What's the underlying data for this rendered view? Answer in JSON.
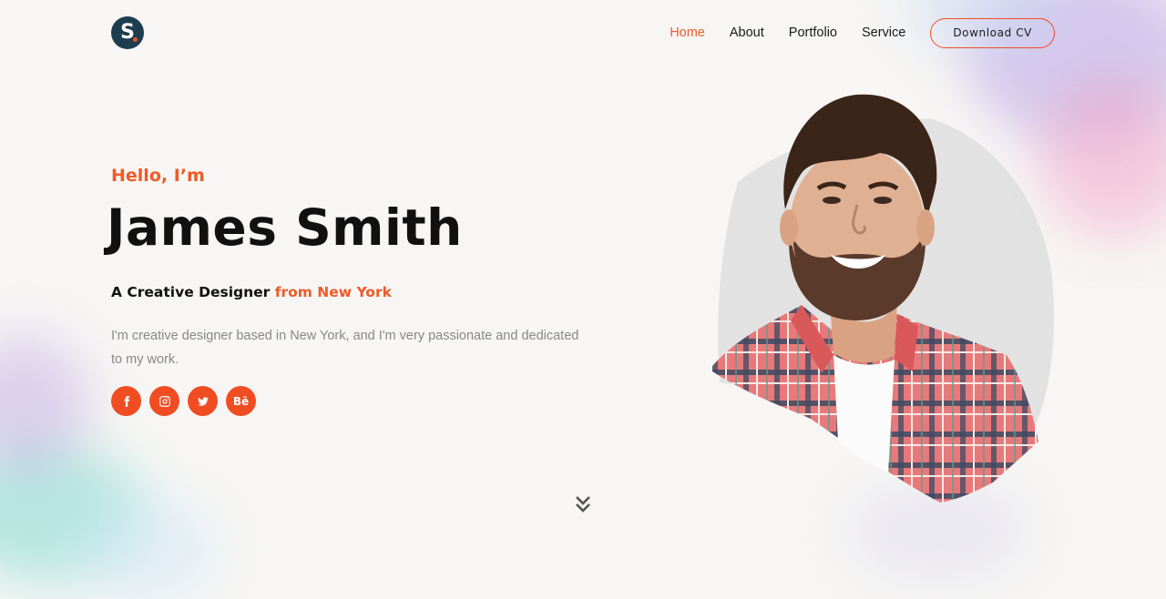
{
  "header": {
    "logo_letter": "S",
    "nav": [
      {
        "label": "Home",
        "active": true
      },
      {
        "label": "About",
        "active": false
      },
      {
        "label": "Portfolio",
        "active": false
      },
      {
        "label": "Service",
        "active": false
      }
    ],
    "cta_label": "Download CV"
  },
  "hero": {
    "greeting": "Hello, I’m",
    "name": "James Smith",
    "tagline_prefix": "A Creative Designer ",
    "tagline_accent": "from New York",
    "description": "I'm creative designer based in New York, and I'm very passionate and dedicated to my work.",
    "socials": [
      {
        "icon": "facebook-icon"
      },
      {
        "icon": "instagram-icon"
      },
      {
        "icon": "twitter-icon"
      },
      {
        "icon": "behance-icon",
        "text": "Bē"
      }
    ]
  },
  "colors": {
    "accent": "#f05a28",
    "logo_bg": "#1c3e4f",
    "text_dark": "#111111",
    "text_muted": "#888888",
    "background": "#f7f6f4"
  },
  "portrait": {
    "subject": "man-portrait",
    "shirt": "red-plaid"
  }
}
